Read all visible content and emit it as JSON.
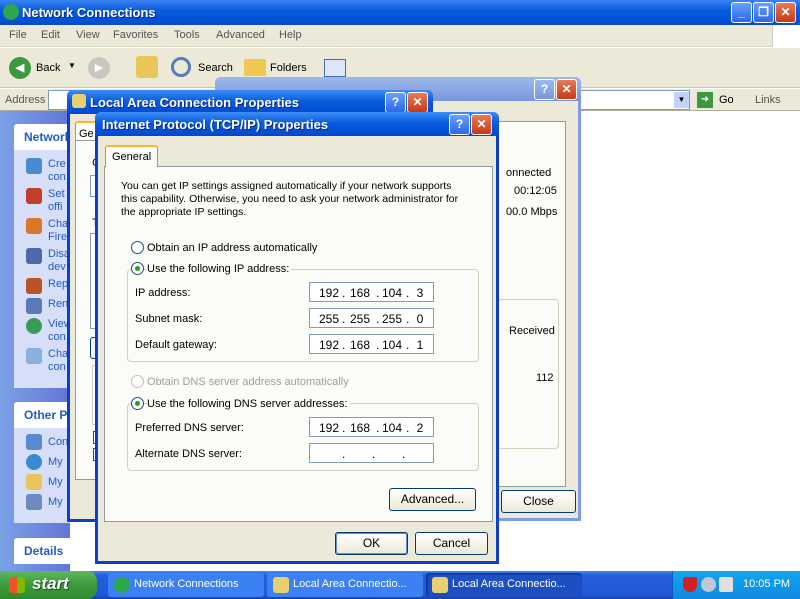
{
  "main": {
    "title": "Network Connections",
    "menu": [
      "File",
      "Edit",
      "View",
      "Favorites",
      "Tools",
      "Advanced",
      "Help"
    ],
    "toolbar": {
      "back": "Back",
      "search": "Search",
      "folders": "Folders"
    },
    "address_label": "Address",
    "go_label": "Go",
    "links_label": "Links",
    "tasks_header": "Network",
    "tasks": [
      "Cre\ncon",
      "Set\noffi",
      "Cha\nFire",
      "Disa\ndev",
      "Rep",
      "Ren",
      "View\ncon",
      "Cha\ncon"
    ],
    "other_header": "Other P",
    "other": [
      "Con",
      "My",
      "My",
      "My"
    ],
    "details_header": "Details"
  },
  "lac": {
    "title": "Local Area Connection Properties",
    "tab_fragment": "Ge",
    "c_fragment": "C",
    "t_fragment": "T"
  },
  "status": {
    "connected": "onnected",
    "duration": "00:12:05",
    "speed": "00.0 Mbps",
    "received_label": "Received",
    "received_value": "112",
    "close_label": "Close"
  },
  "tcp": {
    "title": "Internet Protocol (TCP/IP) Properties",
    "tab": "General",
    "description": "You can get IP settings assigned automatically if your network supports\nthis capability. Otherwise, you need to ask your network administrator for\nthe appropriate IP settings.",
    "obtain_ip_auto": "Obtain an IP address automatically",
    "use_following_ip": "Use the following IP address:",
    "ip_label": "IP address:",
    "ip_value": [
      "192",
      "168",
      "104",
      "3"
    ],
    "subnet_label": "Subnet mask:",
    "subnet_value": [
      "255",
      "255",
      "255",
      "0"
    ],
    "gateway_label": "Default gateway:",
    "gateway_value": [
      "192",
      "168",
      "104",
      "1"
    ],
    "obtain_dns_auto": "Obtain DNS server address automatically",
    "use_following_dns": "Use the following DNS server addresses:",
    "pref_dns_label": "Preferred DNS server:",
    "pref_dns_value": [
      "192",
      "168",
      "104",
      "2"
    ],
    "alt_dns_label": "Alternate DNS server:",
    "alt_dns_value": [
      "",
      "",
      "",
      ""
    ],
    "advanced_label": "Advanced...",
    "ok_label": "OK",
    "cancel_label": "Cancel"
  },
  "taskbar": {
    "start": "start",
    "tasks": [
      "Network Connections",
      "Local Area Connectio...",
      "Local Area Connectio..."
    ],
    "clock": "10:05 PM"
  },
  "colors": {
    "title_blue": "#0054e3",
    "taskbar_blue": "#245edb",
    "start_green": "#3c9a3c"
  }
}
